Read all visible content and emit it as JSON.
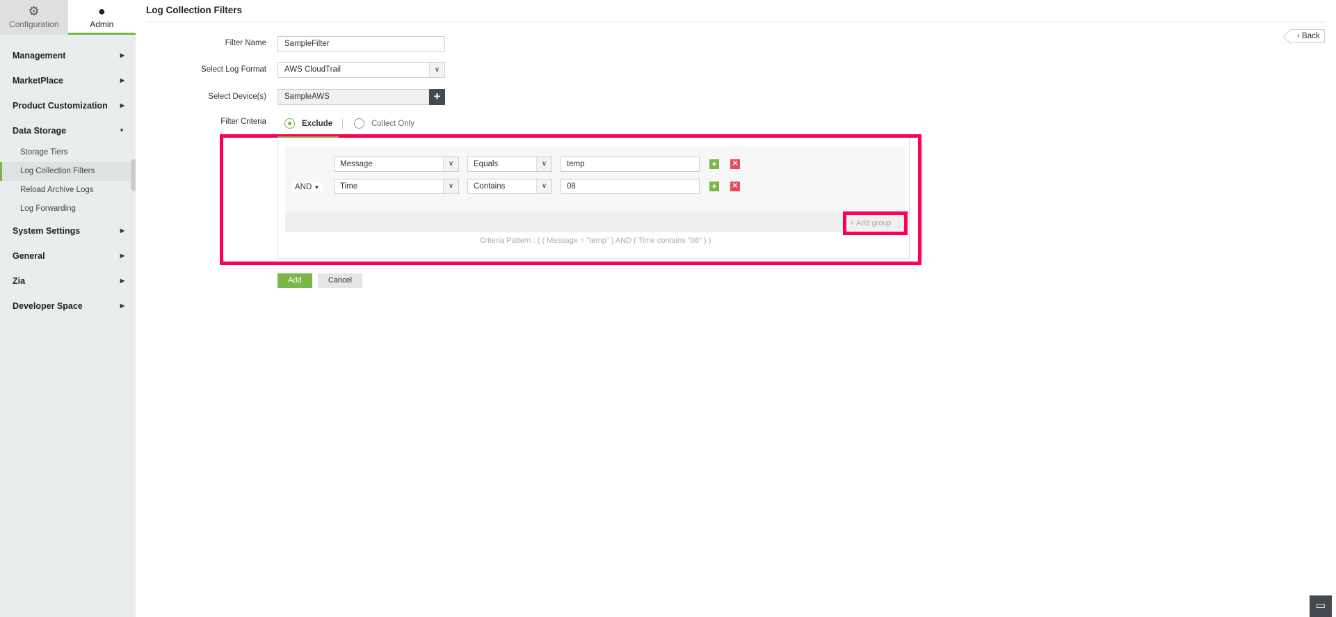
{
  "sidebar": {
    "tabs": [
      {
        "label": "Configuration",
        "icon": "gear-icon"
      },
      {
        "label": "Admin",
        "icon": "user-icon"
      }
    ],
    "items": [
      {
        "label": "Management"
      },
      {
        "label": "MarketPlace"
      },
      {
        "label": "Product Customization"
      },
      {
        "label": "Data Storage",
        "expanded": true,
        "children": [
          {
            "label": "Storage Tiers"
          },
          {
            "label": "Log Collection Filters",
            "active": true
          },
          {
            "label": "Reload Archive Logs"
          },
          {
            "label": "Log Forwarding"
          }
        ]
      },
      {
        "label": "System Settings"
      },
      {
        "label": "General"
      },
      {
        "label": "Zia"
      },
      {
        "label": "Developer Space"
      }
    ]
  },
  "header": {
    "title": "Log Collection Filters",
    "back_label": "Back"
  },
  "form": {
    "filter_name_label": "Filter Name",
    "filter_name_value": "SampleFilter",
    "log_format_label": "Select Log Format",
    "log_format_value": "AWS CloudTrail",
    "devices_label": "Select Device(s)",
    "devices_value": "SampleAWS",
    "criteria_label": "Filter Criteria",
    "criteria_options": [
      {
        "label": "Exclude",
        "selected": true
      },
      {
        "label": "Collect Only",
        "selected": false
      }
    ],
    "conditions": [
      {
        "field": "Message",
        "operator": "Equals",
        "value": "temp"
      },
      {
        "joiner": "AND",
        "field": "Time",
        "operator": "Contains",
        "value": "08"
      }
    ],
    "add_group_label": "Add group",
    "pattern": "Criteria Pattern : ( ( Message = \"temp\" ) AND ( Time contains \"08\" ) )",
    "add_label": "Add",
    "cancel_label": "Cancel"
  },
  "colors": {
    "accent": "#7ab648",
    "highlight": "#ff0050",
    "danger": "#e74c5b",
    "dark": "#434a50"
  }
}
